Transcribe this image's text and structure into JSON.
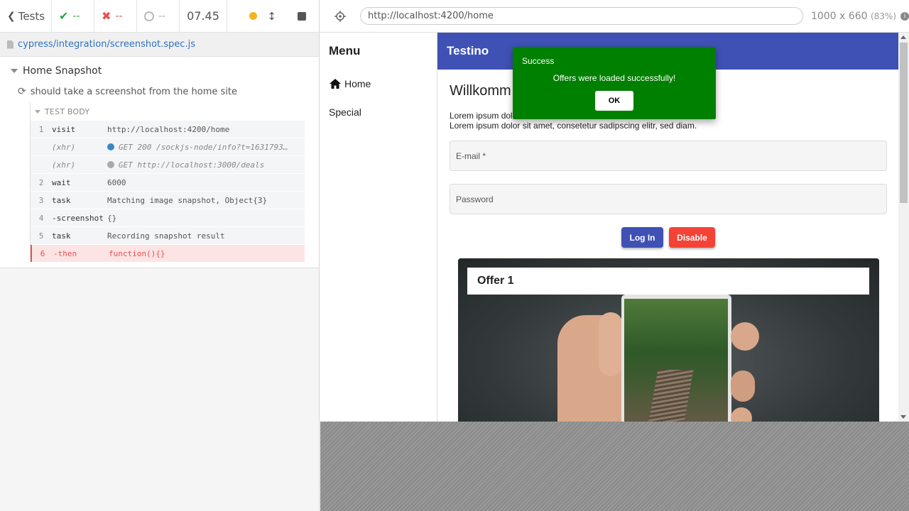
{
  "reporter": {
    "tests_label": "Tests",
    "passed": "--",
    "failed": "--",
    "pending": "--",
    "duration": "07.45",
    "spec_path": "cypress/integration/screenshot.spec.js",
    "suite": "Home Snapshot",
    "test": "should take a screenshot from the home site",
    "hook_label": "TEST BODY",
    "commands": [
      {
        "num": "1",
        "name": "visit",
        "msg": "http://localhost:4200/home"
      },
      {
        "num": "",
        "name": "(xhr)",
        "msg": "GET 200 /sockjs-node/info?t=1631793…",
        "dot": "#3a86c8"
      },
      {
        "num": "",
        "name": "(xhr)",
        "msg": "GET http://localhost:3000/deals",
        "dot": "#aaaaaa"
      },
      {
        "num": "2",
        "name": "wait",
        "msg": "6000"
      },
      {
        "num": "3",
        "name": "task",
        "msg": "Matching image snapshot, Object{3}"
      },
      {
        "num": "4",
        "name": "-screenshot",
        "msg": "{}"
      },
      {
        "num": "5",
        "name": "task",
        "msg": "Recording snapshot result"
      },
      {
        "num": "6",
        "name": "-then",
        "msg": "function(){}"
      }
    ],
    "colors": {
      "pass": "#28a745",
      "fail": "#e94f4f",
      "running": "#f5b31e"
    }
  },
  "browser": {
    "url": "http://localhost:4200/home",
    "viewport": "1000 x 660",
    "scale": "(83%)",
    "info_icon": "i"
  },
  "app": {
    "menu_title": "Menu",
    "menu_items": [
      "Home",
      "Special"
    ],
    "toolbar_title": "Testino",
    "welcome": "Willkomm",
    "lorem_line1": "Lorem ipsum dolo",
    "lorem_line2": "Lorem ipsum dolor sit amet, consetetur sadipscing elitr, sed diam.",
    "email_placeholder": "E-mail *",
    "password_placeholder": "Password",
    "login_label": "Log In",
    "disable_label": "Disable",
    "offer_title": "Offer 1",
    "colors": {
      "toolbar": "#3f51b5",
      "login": "#3f51b5",
      "disable": "#f44336",
      "dialog": "#008000"
    }
  },
  "dialog": {
    "title": "Success",
    "message": "Offers were loaded successfully!",
    "ok_label": "OK"
  }
}
